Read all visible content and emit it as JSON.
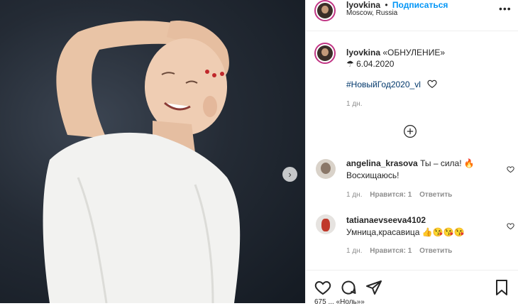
{
  "post": {
    "photo_label": "photo",
    "author": "lyovkina",
    "bullet": "•",
    "follow_label": "Подписаться",
    "location": "Moscow, Russia",
    "more_label": "•••",
    "caption_text": "«ОБНУЛЕНИЕ»",
    "caption_date": "☂ 6.04.2020",
    "hashtag": "#НовыйГод2020_vl",
    "time": "1 дн.",
    "next_arrow": "›"
  },
  "comments": [
    {
      "user": "angelina_krasova",
      "text": "Ты – сила! 🔥 Восхищаюсь!",
      "time": "1 дн.",
      "likes": "Нравится: 1",
      "reply": "Ответить"
    },
    {
      "user": "tatianaevseeva4102",
      "text": "Умница,красавица 👍😘😘😘",
      "time": "1 дн.",
      "likes": "Нравится: 1",
      "reply": "Ответить"
    }
  ],
  "footer": {
    "partial_text": "675 ... «Ноль»»"
  },
  "colors": {
    "follow": "#0095f6",
    "hashtag": "#00376b",
    "muted": "#8e8e8e",
    "background_wall": "#1f2630"
  },
  "icons": [
    "heart-icon",
    "comment-icon",
    "share-icon",
    "bookmark-icon",
    "plus-circle-icon",
    "chevron-right-icon",
    "more-icon"
  ]
}
